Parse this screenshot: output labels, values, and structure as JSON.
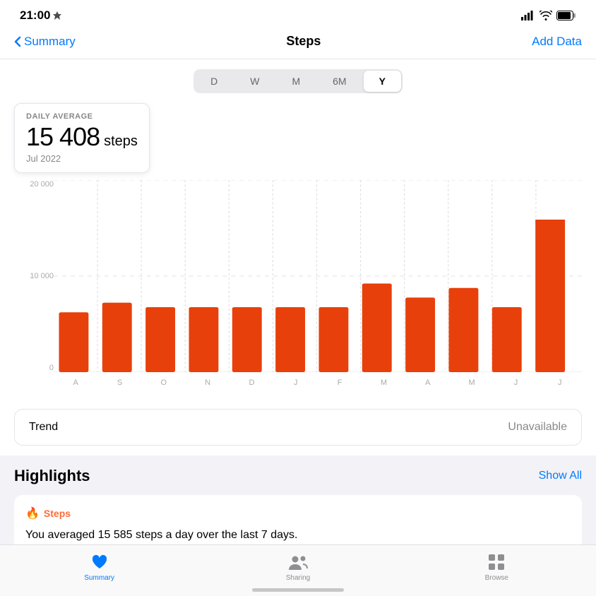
{
  "statusBar": {
    "time": "21:00",
    "locationIcon": "◂",
    "signalBars": "||||",
    "wifiIcon": "wifi",
    "batteryIcon": "battery"
  },
  "nav": {
    "backLabel": "Summary",
    "title": "Steps",
    "actionLabel": "Add Data"
  },
  "periodTabs": {
    "tabs": [
      "D",
      "W",
      "M",
      "6M",
      "Y"
    ],
    "activeIndex": 4
  },
  "stats": {
    "label": "DAILY AVERAGE",
    "number": "15 408",
    "unit": "steps",
    "date": "Jul 2022"
  },
  "chart": {
    "yLabels": [
      "20 000",
      "10 000",
      "0"
    ],
    "xLabels": [
      "A",
      "S",
      "O",
      "N",
      "D",
      "J",
      "F",
      "M",
      "A",
      "M",
      "J",
      "J"
    ],
    "barValues": [
      6200,
      7200,
      6800,
      6800,
      6800,
      6800,
      6800,
      9200,
      7800,
      8800,
      6800,
      16000
    ],
    "highlightIndex": 11,
    "color": "#e8400a"
  },
  "trend": {
    "label": "Trend",
    "value": "Unavailable"
  },
  "highlights": {
    "sectionTitle": "Highlights",
    "showAllLabel": "Show All",
    "cards": [
      {
        "tagIcon": "🔥",
        "tagText": "Steps",
        "description": "You averaged 15 585 steps a day over the last 7 days."
      }
    ]
  },
  "tabBar": {
    "tabs": [
      {
        "id": "summary",
        "label": "Summary",
        "active": true
      },
      {
        "id": "sharing",
        "label": "Sharing",
        "active": false
      },
      {
        "id": "browse",
        "label": "Browse",
        "active": false
      }
    ]
  }
}
